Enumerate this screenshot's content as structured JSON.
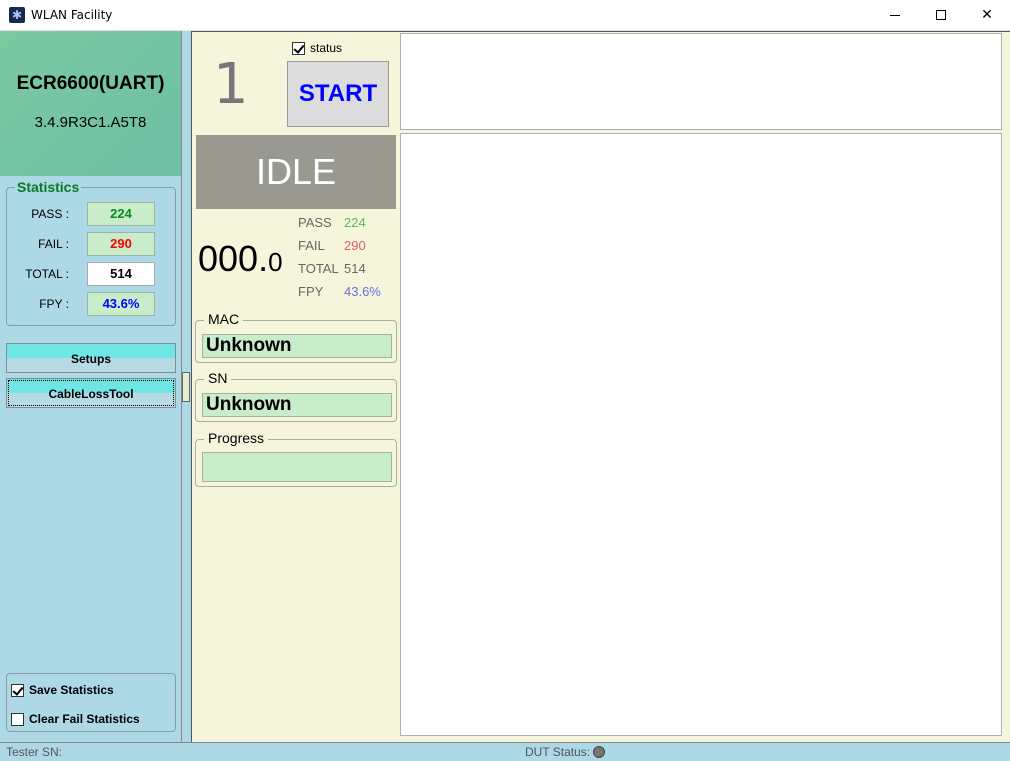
{
  "window": {
    "title": "WLAN Facility"
  },
  "sidebar": {
    "model_name": "ECR6600(UART)",
    "model_version": "3.4.9R3C1.A5T8",
    "statistics": {
      "legend": "Statistics",
      "pass_label": "PASS :",
      "pass_value": "224",
      "fail_label": "FAIL :",
      "fail_value": "290",
      "total_label": "TOTAL :",
      "total_value": "514",
      "fpy_label": "FPY :",
      "fpy_value": "43.6%"
    },
    "buttons": {
      "setups": "Setups",
      "cable_loss_tool": "CableLossTool"
    },
    "options": {
      "save_statistics": {
        "label": "Save Statistics",
        "checked": true
      },
      "clear_fail_statistics": {
        "label": "Clear Fail Statistics",
        "checked": false
      }
    }
  },
  "main": {
    "slot_number": "1",
    "status_checkbox": {
      "label": "status",
      "checked": true
    },
    "start_button": "START",
    "state": "IDLE",
    "timer": {
      "whole": "000.",
      "fraction": "0"
    },
    "mini_stats": [
      {
        "label": "PASS",
        "value": "224",
        "color": "#5cb85c"
      },
      {
        "label": "FAIL",
        "value": "290",
        "color": "#e06060"
      },
      {
        "label": "TOTAL",
        "value": "514",
        "color": "#666666"
      },
      {
        "label": "FPY",
        "value": "43.6%",
        "color": "#6b6be0"
      }
    ],
    "mac": {
      "legend": "MAC",
      "value": "Unknown"
    },
    "sn": {
      "legend": "SN",
      "value": "Unknown"
    },
    "progress": {
      "legend": "Progress",
      "percent": 0
    }
  },
  "statusbar": {
    "tester_sn_label": "Tester SN:",
    "dut_status_label": "DUT Status:"
  },
  "colors": {
    "pass": "#0a8a1a",
    "fail": "#ff0000",
    "total": "#000000",
    "fpy": "#0000ff",
    "start": "#0000ff"
  }
}
